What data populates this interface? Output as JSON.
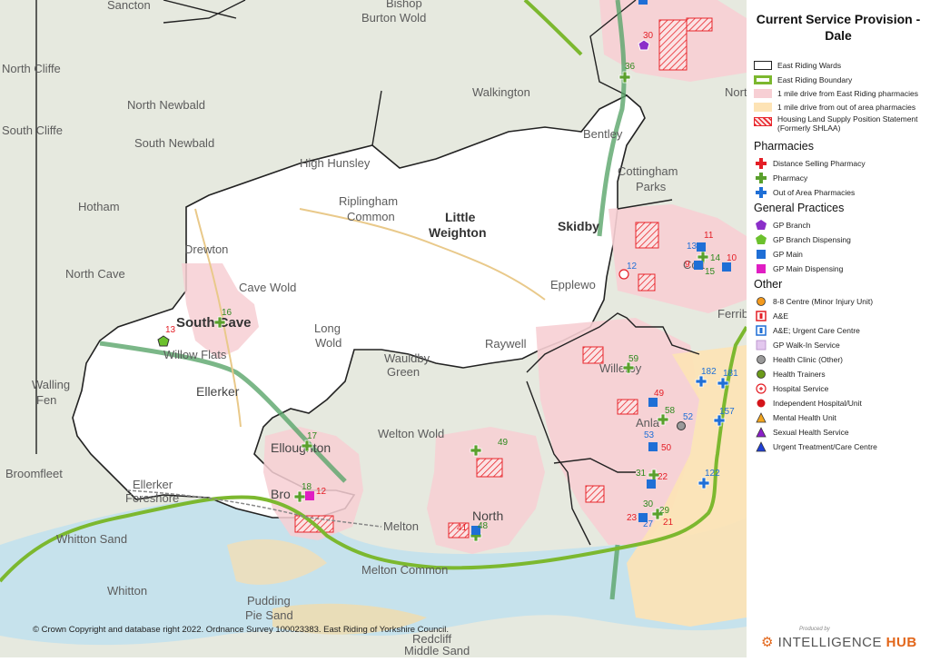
{
  "map": {
    "title": "Current Service Provision - Dale",
    "copyright": "© Crown Copyright and database right 2022. Ordnance Survey 100023383. East Riding of Yorkshire Council.",
    "produced_by": "Produced by",
    "logo_prefix": "INTELLIGENCE",
    "logo_suffix": "HUB",
    "place_labels": [
      "Sancton",
      "Bishop",
      "Burton Wold",
      "North Cliffe",
      "South Cliffe",
      "North Newbald",
      "South Newbald",
      "Hotham",
      "High Hunsley",
      "Riplingham",
      "Common",
      "Little",
      "Weighton",
      "Skidby",
      "Bentley",
      "Cottingham",
      "Parks",
      "Drewton",
      "North Cave",
      "Cave Wold",
      "South Cave",
      "Willow Flats",
      "Long",
      "Wold",
      "Epplewo",
      "Raywell",
      "Walling",
      "Fen",
      "Wauldby",
      "Green",
      "Ellerker",
      "Welton Wold",
      "Elloughton",
      "Broomfleet",
      "Ellerker",
      "Foreshore",
      "Bro",
      "Melton",
      "North",
      "Whitton Sand",
      "Melton Common",
      "Whitton",
      "Pudding",
      "Pie Sand",
      "Redcliff",
      "Middle Sand",
      "Walkington",
      "Willerby",
      "Anla",
      "Cott",
      "North",
      "Ferriby"
    ],
    "markers": [
      "30",
      "36",
      "11",
      "13",
      "14",
      "10",
      "9",
      "15",
      "12",
      "16",
      "13",
      "59",
      "182",
      "181",
      "49",
      "58",
      "52",
      "157",
      "53",
      "50",
      "17",
      "49",
      "31",
      "22",
      "122",
      "18",
      "12",
      "30",
      "29",
      "23",
      "21",
      "27",
      "41",
      "48"
    ]
  },
  "legend": {
    "boundaries": [
      {
        "label": "East Riding Wards",
        "color": "#222222"
      },
      {
        "label": "East Riding Boundary",
        "color": "#7cb82f"
      },
      {
        "label": "1 mile drive from East Riding pharmacies",
        "color": "#f7cfd4"
      },
      {
        "label": "1 mile drive from out of area pharmacies",
        "color": "#fde3b5"
      },
      {
        "label": "Housing Land Supply Position Statement (Formerly SHLAA)",
        "color": "#e8252b"
      }
    ],
    "pharmacies_heading": "Pharmacies",
    "pharmacies": [
      {
        "label": "Distance Selling Pharmacy",
        "icon": "plus-red",
        "color": "#e41e26"
      },
      {
        "label": "Pharmacy",
        "icon": "plus-green",
        "color": "#5aa02c"
      },
      {
        "label": "Out of Area Pharmacies",
        "icon": "plus-blue",
        "color": "#1f6fd6"
      }
    ],
    "gp_heading": "General Practices",
    "gp": [
      {
        "label": "GP Branch",
        "icon": "pentagon-purple",
        "color": "#8b2fc9"
      },
      {
        "label": "GP Branch Dispensing",
        "icon": "pentagon-green",
        "color": "#6cc12d"
      },
      {
        "label": "GP Main",
        "icon": "square-blue",
        "color": "#1f6fd6"
      },
      {
        "label": "GP Main Dispensing",
        "icon": "square-magenta",
        "color": "#e01ec3"
      }
    ],
    "other_heading": "Other",
    "other": [
      {
        "label": "8-8 Centre (Minor Injury Unit)",
        "icon": "circle-orange",
        "color": "#f39a1e"
      },
      {
        "label": "A&E",
        "icon": "ae-red",
        "color": "#e41e26"
      },
      {
        "label": "A&E; Urgent Care Centre",
        "icon": "ae-blue",
        "color": "#1f6fd6"
      },
      {
        "label": "GP Walk-In Service",
        "icon": "square-lilac",
        "color": "#e3c8ee"
      },
      {
        "label": "Health Clinic (Other)",
        "icon": "circle-grey",
        "color": "#9a9a9a"
      },
      {
        "label": "Health Trainers",
        "icon": "circle-olive",
        "color": "#6b9a1a"
      },
      {
        "label": "Hospital Service",
        "icon": "hospital-red",
        "color": "#e41e26"
      },
      {
        "label": "Independent Hospital/Unit",
        "icon": "circle-red",
        "color": "#d4141a"
      },
      {
        "label": "Mental Health Unit",
        "icon": "triangle-orange",
        "color": "#f3a51e"
      },
      {
        "label": "Sexual Health Service",
        "icon": "triangle-purple",
        "color": "#8b1fc9"
      },
      {
        "label": "Urgent Treatment/Care Centre",
        "icon": "triangle-blue",
        "color": "#1f3fd6"
      }
    ]
  }
}
